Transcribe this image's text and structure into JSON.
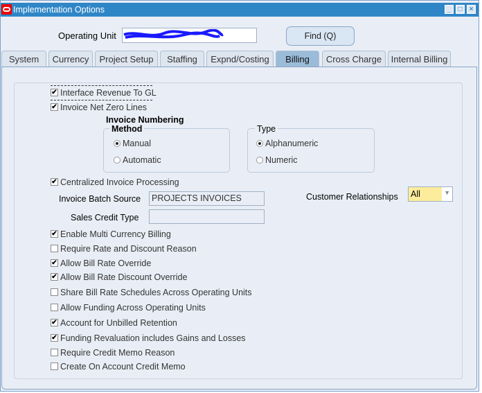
{
  "window": {
    "title": "Implementation Options",
    "min": "_",
    "max": "□",
    "close": "×"
  },
  "header": {
    "operating_unit_label": "Operating Unit",
    "operating_unit_value": "",
    "find_label": "Find (Q)"
  },
  "tabs": [
    "System",
    "Currency",
    "Project Setup",
    "Staffing",
    "Expnd/Costing",
    "Billing",
    "Cross Charge",
    "Internal Billing"
  ],
  "active_tab": "Billing",
  "billing": {
    "top_checks": [
      {
        "label": "Interface Revenue To GL",
        "checked": true
      },
      {
        "label": "Invoice Net Zero Lines",
        "checked": true
      }
    ],
    "numbering_title": "Invoice Numbering",
    "method": {
      "legend": "Method",
      "options": [
        {
          "label": "Manual",
          "selected": true
        },
        {
          "label": "Automatic",
          "selected": false
        }
      ]
    },
    "type": {
      "legend": "Type",
      "options": [
        {
          "label": "Alphanumeric",
          "selected": true
        },
        {
          "label": "Numeric",
          "selected": false
        }
      ]
    },
    "centralized": {
      "label": "Centralized Invoice Processing",
      "checked": true
    },
    "batch_source_label": "Invoice Batch Source",
    "batch_source_value": "PROJECTS INVOICES",
    "sales_credit_label": "Sales Credit Type",
    "sales_credit_value": "",
    "cust_rel_label": "Customer Relationships",
    "cust_rel_value": "All",
    "checks": [
      {
        "label": "Enable Multi Currency Billing",
        "checked": true
      },
      {
        "label": "Require Rate and Discount Reason",
        "checked": false
      },
      {
        "label": "Allow Bill Rate Override",
        "checked": true
      },
      {
        "label": "Allow Bill Rate Discount Override",
        "checked": true
      },
      {
        "label": "Share Bill Rate Schedules Across Operating Units",
        "checked": false
      },
      {
        "label": "Allow Funding Across Operating Units",
        "checked": false
      },
      {
        "label": "Account for Unbilled Retention",
        "checked": true
      },
      {
        "label": "Funding Revaluation includes Gains and Losses",
        "checked": true
      },
      {
        "label": "Require Credit Memo Reason",
        "checked": false
      },
      {
        "label": "Create On Account Credit Memo",
        "checked": false
      }
    ]
  }
}
